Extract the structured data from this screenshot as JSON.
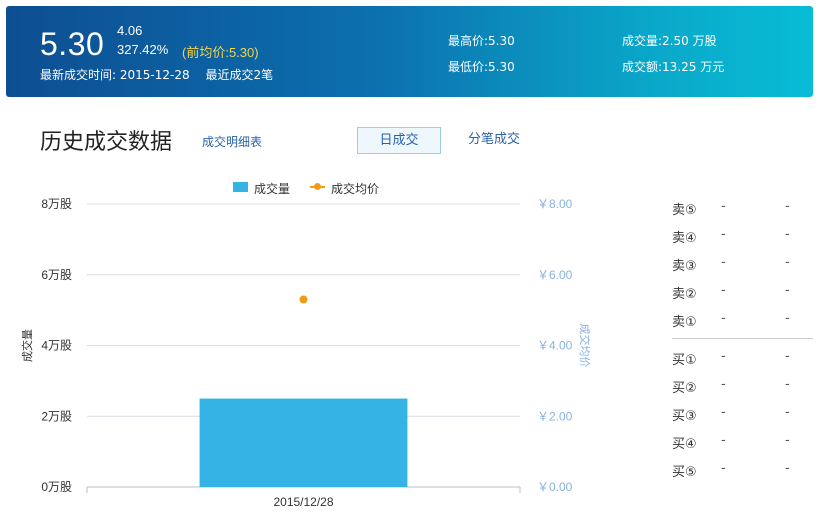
{
  "quote": {
    "price": "5.30",
    "change": "4.06",
    "change_pct": "327.42%",
    "prev_avg": "(前均价:5.30)",
    "latest_time": "最新成交时间: 2015-12-28",
    "recent_trades": "最近成交2笔",
    "high": "最高价:5.30",
    "low": "最低价:5.30",
    "volume": "成交量:2.50 万股",
    "amount": "成交额:13.25 万元"
  },
  "section": {
    "title": "历史成交数据",
    "detail_link": "成交明细表",
    "tab_day": "日成交",
    "tab_tick": "分笔成交"
  },
  "legend": {
    "volume": "成交量",
    "avg_price": "成交均价"
  },
  "colors": {
    "bar": "#35b3e5",
    "avg_point": "#f39c12",
    "grid": "#d9dde3",
    "right_axis": "#8ab1e0"
  },
  "chart_data": {
    "type": "bar",
    "categories": [
      "2015/12/28"
    ],
    "series": [
      {
        "name": "成交量",
        "type": "bar",
        "axis": "left",
        "values": [
          2.5
        ]
      },
      {
        "name": "成交均价",
        "type": "scatter",
        "axis": "right",
        "values": [
          5.3
        ]
      }
    ],
    "xlabel": "",
    "ylabel": "成交量",
    "y2label": "成交均价",
    "ylim": [
      0,
      8
    ],
    "y2lim": [
      0,
      8
    ],
    "yticks": [
      "0万股",
      "2万股",
      "4万股",
      "6万股",
      "8万股"
    ],
    "y2ticks": [
      "￥0.00",
      "￥2.00",
      "￥4.00",
      "￥6.00",
      "￥8.00"
    ],
    "grid": true,
    "legend_position": "top"
  },
  "orderbook": {
    "sell": [
      {
        "label": "卖⑤",
        "price": "-",
        "volume": "-"
      },
      {
        "label": "卖④",
        "price": "-",
        "volume": "-"
      },
      {
        "label": "卖③",
        "price": "-",
        "volume": "-"
      },
      {
        "label": "卖②",
        "price": "-",
        "volume": "-"
      },
      {
        "label": "卖①",
        "price": "-",
        "volume": "-"
      }
    ],
    "buy": [
      {
        "label": "买①",
        "price": "-",
        "volume": "-"
      },
      {
        "label": "买②",
        "price": "-",
        "volume": "-"
      },
      {
        "label": "买③",
        "price": "-",
        "volume": "-"
      },
      {
        "label": "买④",
        "price": "-",
        "volume": "-"
      },
      {
        "label": "买⑤",
        "price": "-",
        "volume": "-"
      }
    ]
  }
}
